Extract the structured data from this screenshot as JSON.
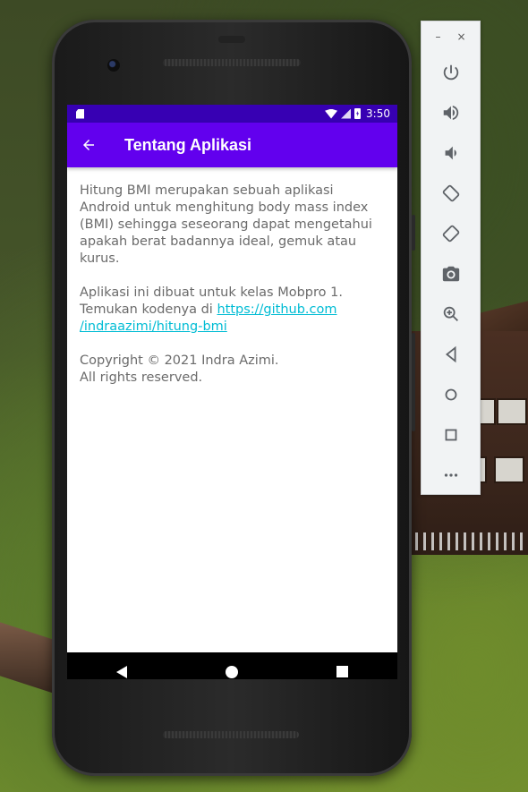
{
  "status_bar": {
    "time": "3:50"
  },
  "app_bar": {
    "title": "Tentang Aplikasi",
    "back_icon": "arrow-back-icon"
  },
  "content": {
    "paragraph1": "Hitung BMI merupakan sebuah aplikasi Android untuk menghitung body mass index (BMI) sehingga seseorang dapat mengetahui apakah berat badannya ideal, gemuk atau kurus.",
    "paragraph2_prefix_line1": "Aplikasi ini dibuat untuk kelas Mobpro 1.",
    "paragraph2_prefix_line2": "Temukan kodenya di ",
    "link_part1": "https://github.com",
    "link_part2": "/indraazimi/hitung-bmi",
    "copyright_line1": "Copyright © 2021 Indra Azimi.",
    "copyright_line2": "All rights reserved."
  },
  "navbar": {
    "icons": [
      "nav-back-icon",
      "nav-home-icon",
      "nav-recents-icon"
    ]
  },
  "emulator_toolbar": {
    "minimize": "–",
    "close": "×",
    "buttons": [
      "power-icon",
      "volume-up-icon",
      "volume-down-icon",
      "rotate-left-icon",
      "rotate-right-icon",
      "camera-icon",
      "zoom-icon",
      "back-icon",
      "home-icon",
      "overview-icon",
      "more-icon"
    ]
  },
  "colors": {
    "primary": "#6200ee",
    "primary_dark": "#3700b3",
    "link": "#00bcd4"
  }
}
